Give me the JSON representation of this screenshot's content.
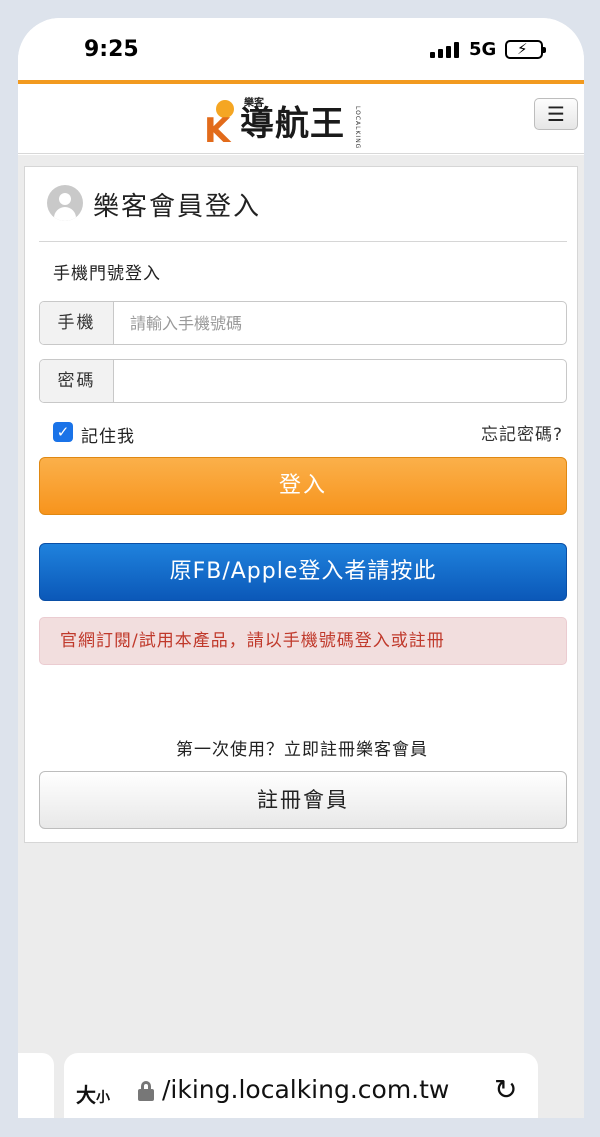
{
  "status": {
    "time": "9:25",
    "network": "5G"
  },
  "header": {
    "logo_small": "樂客",
    "logo_main": "導航王",
    "logo_side": "LOCALKING",
    "menu_icon": "☰"
  },
  "login": {
    "title": "樂客會員登入",
    "subtitle": "手機門號登入",
    "phone_label": "手機",
    "phone_placeholder": "請輸入手機號碼",
    "password_label": "密碼",
    "password_value": "",
    "remember_label": "記住我",
    "remember_checked": true,
    "forgot_label": "忘記密碼?",
    "login_button": "登入",
    "fb_apple_button": "原FB/Apple登入者請按此",
    "notice": "官網訂閱/試用本產品，請以手機號碼登入或註冊",
    "first_time_text": "第一次使用？立即註冊樂客會員",
    "register_button": "註冊會員"
  },
  "browser": {
    "text_size_label_big": "大",
    "text_size_label_small": "小",
    "url": "/iking.localking.com.tw"
  },
  "colors": {
    "accent_orange": "#f7941d",
    "fb_blue": "#0b58b8",
    "alert_bg": "#f2dede",
    "alert_text": "#c0392b",
    "checkbox_blue": "#1a73e8"
  }
}
